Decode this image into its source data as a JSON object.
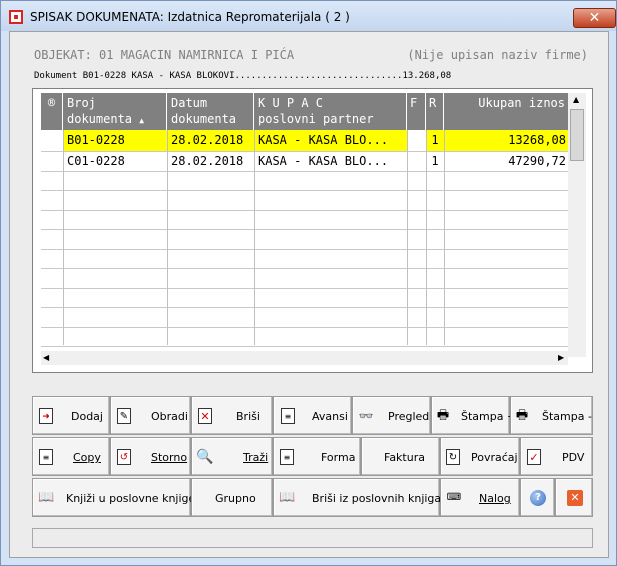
{
  "window": {
    "title": "SPISAK DOKUMENATA: Izdatnica Repromaterijala ( 2 )",
    "close_glyph": "✕"
  },
  "header": {
    "objekat": "OBJEKAT: 01 MAGACIN NAMIRNICA I PIĆA",
    "firma": "(Nije upisan naziv firme)",
    "dokument_line": "Dokument B01-0228  KASA - KASA BLOKOVI...............................13.268,08"
  },
  "grid": {
    "columns": [
      {
        "line1": "®",
        "line2": ""
      },
      {
        "line1": "Broj",
        "line2": "dokumenta"
      },
      {
        "line1": "Datum",
        "line2": "dokumenta"
      },
      {
        "line1": "K U P A C",
        "line2": "poslovni partner"
      },
      {
        "line1": "F",
        "line2": ""
      },
      {
        "line1": "R",
        "line2": ""
      },
      {
        "line1": "Ukupan iznos",
        "line2": ""
      }
    ],
    "sort_glyph": "▲",
    "rows": [
      {
        "broj": "B01-0228",
        "datum": "28.02.2018",
        "kupac": "KASA - KASA BLO...",
        "f": "",
        "r": "1",
        "iznos": "13268,08",
        "selected": true
      },
      {
        "broj": "C01-0228",
        "datum": "28.02.2018",
        "kupac": "KASA - KASA BLO...",
        "f": "",
        "r": "1",
        "iznos": "47290,72",
        "selected": false
      }
    ],
    "selected_color": "#ffff00"
  },
  "buttons": {
    "dodaj": "Dodaj",
    "obradi": "Obradi",
    "brisi": "Briši",
    "avansi": "Avansi",
    "pregled": "Pregled",
    "stampa_plus": "Štampa +",
    "stampa_minus": "Štampa -",
    "copy": "Copy",
    "storno": "Storno",
    "trazi": "Traži",
    "forma": "Forma",
    "faktura": "Faktura",
    "povracaj": "Povraćaj",
    "pdv": "PDV",
    "knjizi": "Knjiži u poslovne knjige *",
    "grupno": "Grupno",
    "brisi_knjige": "Briši iz poslovnih knjiga",
    "nalog": "Nalog"
  }
}
